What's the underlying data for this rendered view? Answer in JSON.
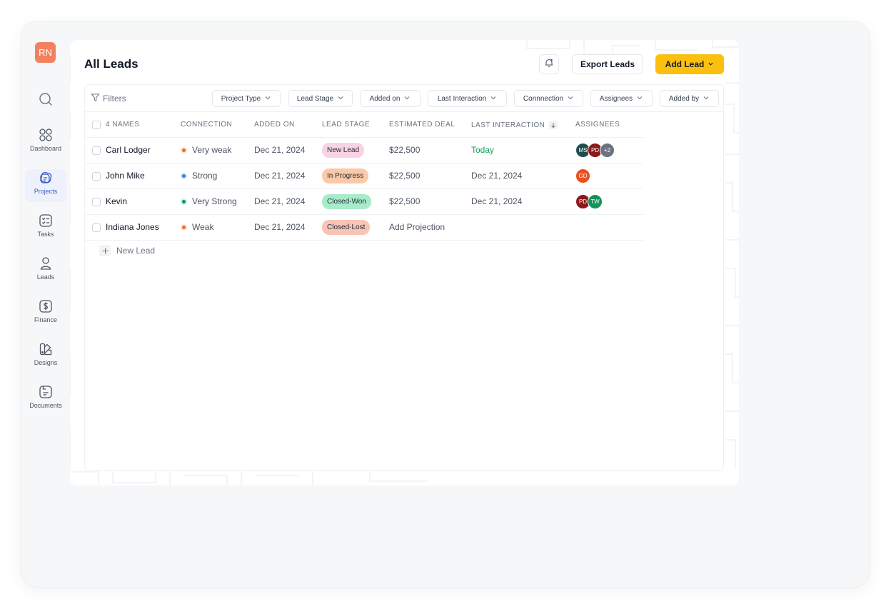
{
  "user": {
    "initials": "RN"
  },
  "sidebar": {
    "items": [
      {
        "label": "Dashboard",
        "icon": "grid-icon"
      },
      {
        "label": "Projects",
        "icon": "projects-icon",
        "active": true
      },
      {
        "label": "Tasks",
        "icon": "tasks-icon"
      },
      {
        "label": "Leads",
        "icon": "user-icon"
      },
      {
        "label": "Finance",
        "icon": "dollar-icon"
      },
      {
        "label": "Designs",
        "icon": "designs-icon"
      },
      {
        "label": "Documents",
        "icon": "document-icon"
      }
    ]
  },
  "header": {
    "title": "All Leads",
    "export_label": "Export Leads",
    "add_label": "Add Lead"
  },
  "filters": {
    "label": "Filters",
    "chips": [
      "Project Type",
      "Lead Stage",
      "Added on",
      "Last Interaction",
      "Connnection",
      "Assignees",
      "Added by"
    ]
  },
  "table": {
    "columns": [
      "4 NAMES",
      "CONNECTION",
      "ADDED ON",
      "LEAD STAGE",
      "ESTIMATED DEAL",
      "LAST INTERACTION",
      "ASSIGNEES"
    ],
    "rows": [
      {
        "name": "Carl Lodger",
        "connection": "Very weak",
        "added_on": "Dec 21, 2024",
        "stage": "New Lead",
        "deal": "$22,500",
        "last_interaction": "Today",
        "assignees": [
          "MS",
          "PD",
          "+2"
        ]
      },
      {
        "name": "John Mike",
        "connection": "Strong",
        "added_on": "Dec 21, 2024",
        "stage": "In Progress",
        "deal": "$22,500",
        "last_interaction": "Dec 21, 2024",
        "assignees": [
          "GD"
        ]
      },
      {
        "name": "Kevin",
        "connection": "Very Strong",
        "added_on": "Dec 21, 2024",
        "stage": "Closed-Won",
        "deal": "$22,500",
        "last_interaction": "Dec 21, 2024",
        "assignees": [
          "PD",
          "TW"
        ]
      },
      {
        "name": "Indiana Jones",
        "connection": "Weak",
        "added_on": "Dec 21, 2024",
        "stage": "Closed-Lost",
        "deal": "Add Projection",
        "last_interaction": "",
        "assignees": []
      }
    ],
    "new_lead_label": "New Lead"
  },
  "colors": {
    "accent": "#fbbf0f",
    "avatar_rn": "#f2825f",
    "active_nav": "#3a5bc7",
    "today": "#1a9c5b",
    "stage_new": "#f9d3e3",
    "stage_progress": "#fbc9a8",
    "stage_won": "#a7ebc9",
    "stage_lost": "#f8c4b6"
  }
}
